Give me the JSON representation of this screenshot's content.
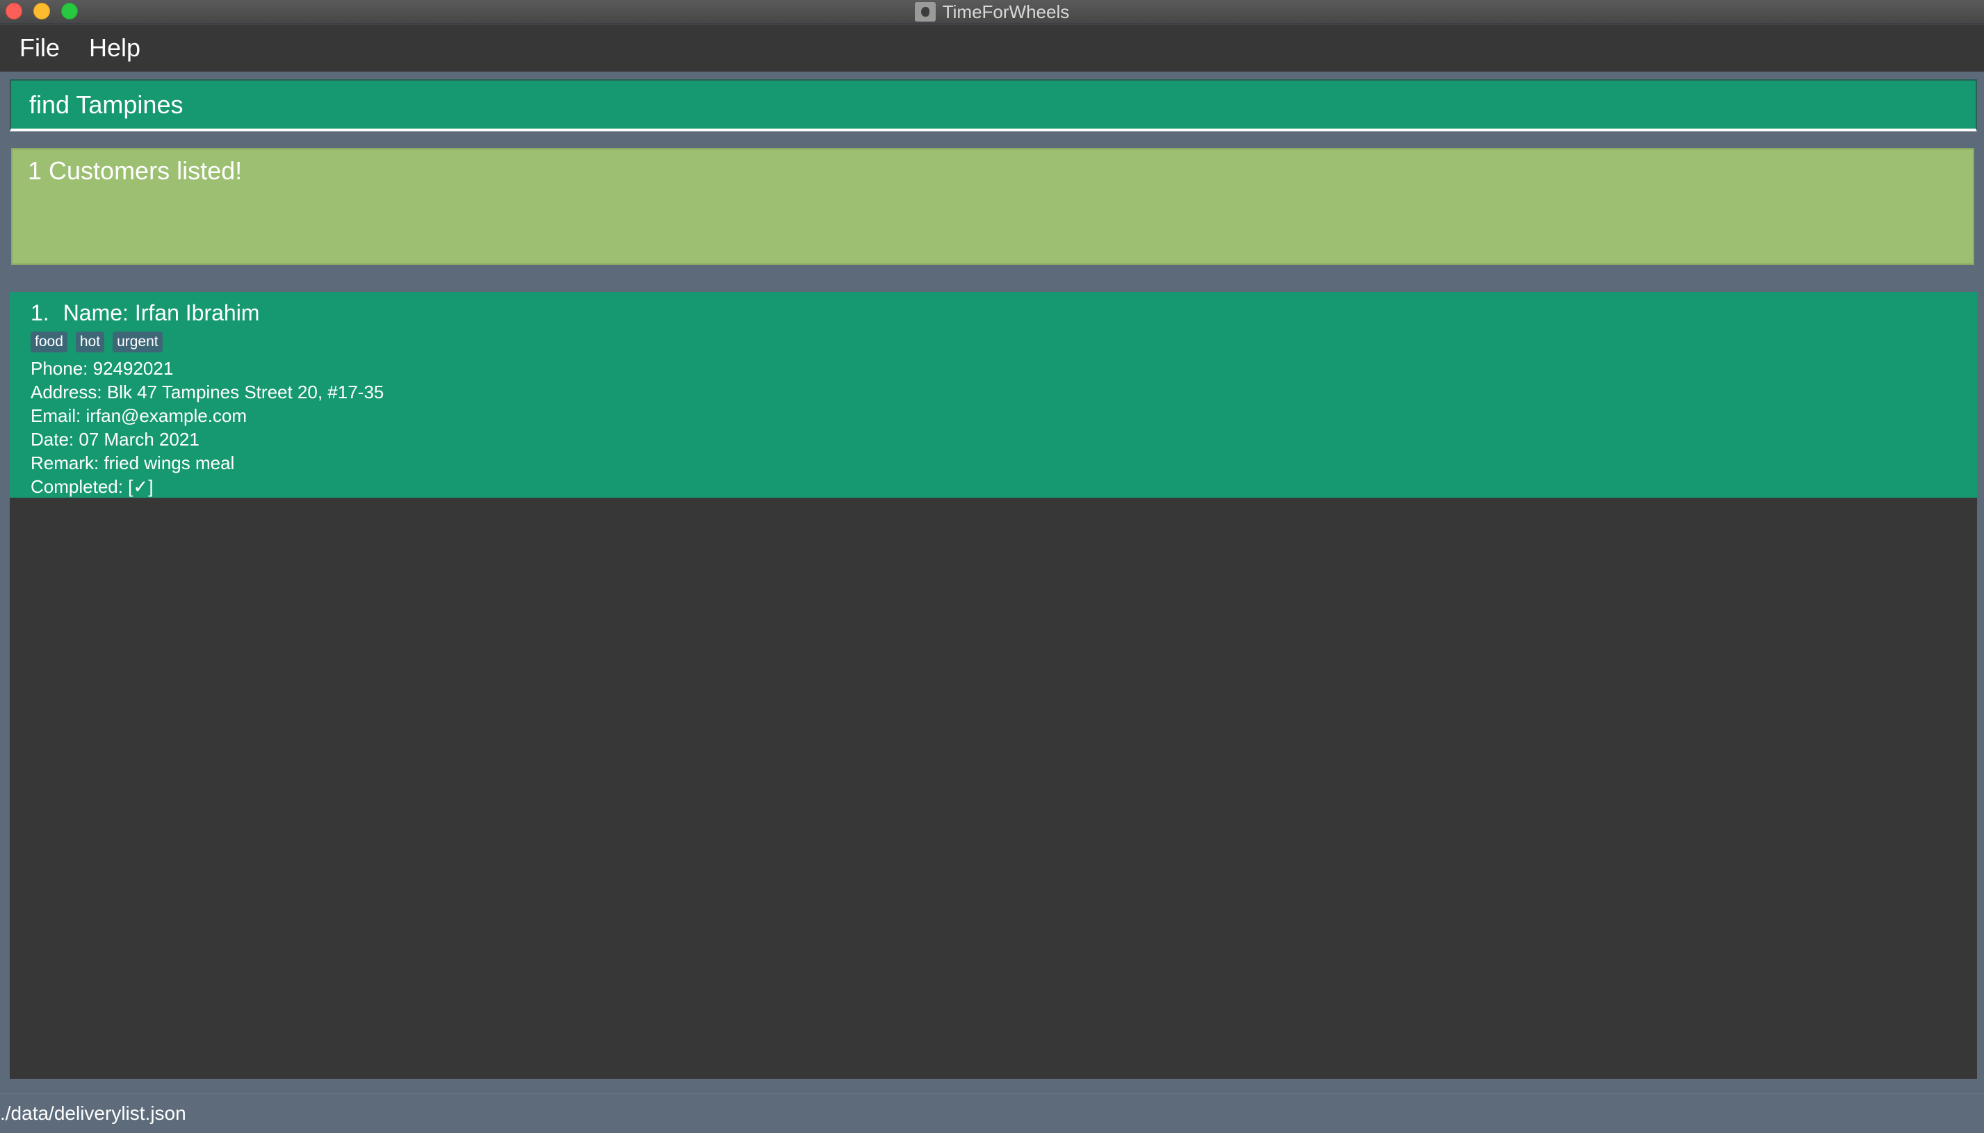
{
  "window": {
    "title": "TimeForWheels"
  },
  "menubar": {
    "items": [
      "File",
      "Help"
    ]
  },
  "command": {
    "value": "find Tampines"
  },
  "result": {
    "message": "1 Customers listed!"
  },
  "customers": [
    {
      "index": "1.",
      "name": "Name: Irfan Ibrahim",
      "tags": [
        "food",
        "hot",
        "urgent"
      ],
      "phone": "Phone: 92492021",
      "address": "Address: Blk 47 Tampines Street 20, #17-35",
      "email": "Email: irfan@example.com",
      "date": "Date: 07 March 2021",
      "remark": "Remark: fried wings meal",
      "completed": "Completed: [✓]"
    }
  ],
  "statusbar": {
    "path": "./data/deliverylist.json"
  },
  "colors": {
    "accent": "#169971",
    "result_bg": "#9cbf72",
    "panel_bg": "#373737",
    "frame_bg": "#5c6a7a",
    "tag_bg": "#3d6777"
  }
}
